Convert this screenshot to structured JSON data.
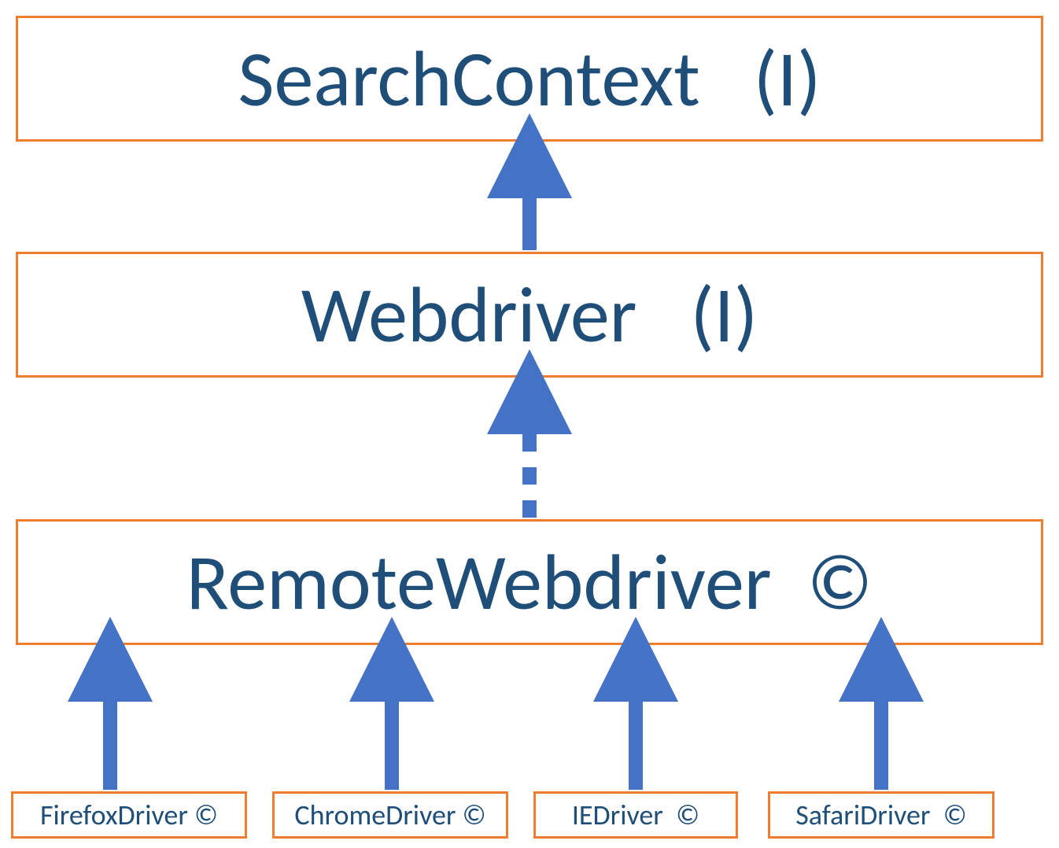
{
  "colors": {
    "border": "#ED7D31",
    "text": "#1F4E79",
    "arrow": "#4472C4"
  },
  "nodes": {
    "top": "SearchContext   (I)",
    "mid": "Webdriver   (I)",
    "remote": "RemoteWebdriver  ©"
  },
  "drivers": [
    "FirefoxDriver ©",
    "ChromeDriver ©",
    "IEDriver  ©",
    "SafariDriver  ©"
  ]
}
